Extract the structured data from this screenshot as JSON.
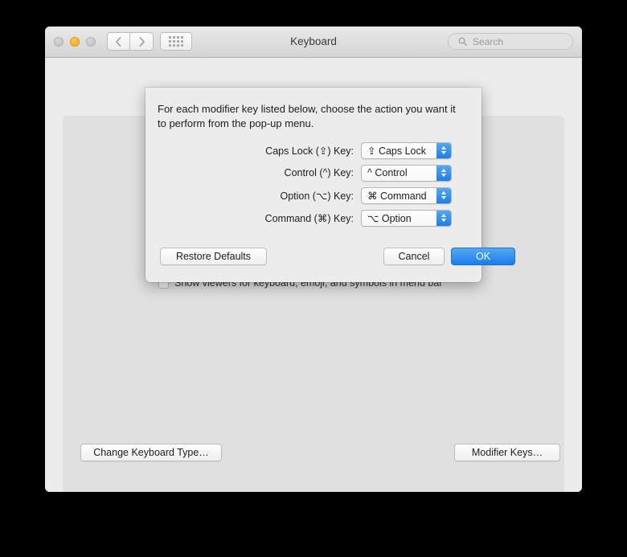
{
  "window": {
    "title": "Keyboard",
    "traffic_lights": [
      {
        "name": "close",
        "state": "inactive"
      },
      {
        "name": "minimize",
        "state": "active-yellow"
      },
      {
        "name": "zoom",
        "state": "inactive"
      }
    ],
    "nav": {
      "back_icon": "chevron-left-icon",
      "forward_icon": "chevron-right-icon",
      "show_all_icon": "grid-dots-icon"
    },
    "search": {
      "placeholder": "Search",
      "value": "",
      "icon": "search-icon"
    }
  },
  "pane": {
    "checkbox": {
      "label": "Show viewers for keyboard, emoji, and symbols in menu bar",
      "checked": false
    },
    "change_keyboard_type_label": "Change Keyboard Type…",
    "modifier_keys_label": "Modifier Keys…",
    "help_label": "?"
  },
  "sheet": {
    "description": "For each modifier key listed below, choose the action you want it to perform from the pop-up menu.",
    "rows": [
      {
        "label": "Caps Lock (⇪) Key:",
        "value": "⇪ Caps Lock"
      },
      {
        "label": "Control (^) Key:",
        "value": "^ Control"
      },
      {
        "label": "Option (⌥) Key:",
        "value": "⌘ Command"
      },
      {
        "label": "Command (⌘) Key:",
        "value": "⌥ Option"
      }
    ],
    "buttons": {
      "restore_defaults": "Restore Defaults",
      "cancel": "Cancel",
      "ok": "OK"
    }
  },
  "colors": {
    "accent_blue": "#1a7ee8",
    "window_bg": "#ececec",
    "panel_bg": "#e0e0e0",
    "minimize_yellow": "#f5ab16"
  }
}
